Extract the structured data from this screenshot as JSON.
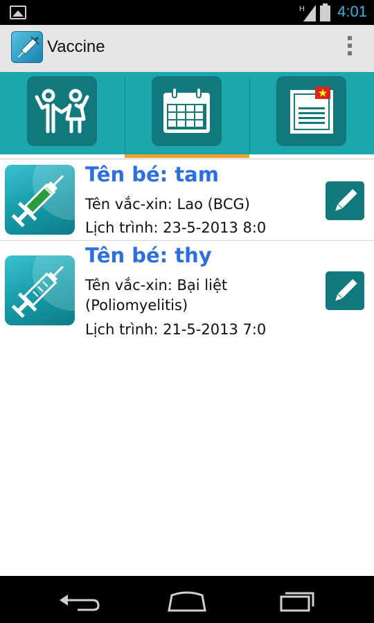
{
  "status_bar": {
    "time": "4:01",
    "icons": [
      "gallery-icon",
      "signal-icon",
      "battery-icon"
    ],
    "network_label": "H",
    "clock_color": "#33b5e5"
  },
  "action_bar": {
    "title": "Vaccine",
    "icons": [
      "syringe-app-icon",
      "overflow-menu-icon"
    ]
  },
  "tabs": [
    {
      "name": "children-tab",
      "icon": "children-icon",
      "selected": false
    },
    {
      "name": "schedule-tab",
      "icon": "calendar-icon",
      "selected": true
    },
    {
      "name": "news-tab",
      "icon": "news-icon",
      "selected": false
    }
  ],
  "colors": {
    "teal": "#1ca7ad",
    "dark_teal": "#11787d",
    "tab_indicator": "#f2a228",
    "name_blue": "#2b6fe0"
  },
  "vaccinations": [
    {
      "name": "Tên bé: tam",
      "vaccine": "Tên vắc-xin: Lao (BCG)",
      "schedule": "Lịch trình: 23-5-2013 8:0",
      "icon": "syringe-green-icon",
      "action_icon": "pencil-icon"
    },
    {
      "name": "Tên bé: thy",
      "vaccine": "Tên vắc-xin: Bại liệt",
      "vaccine_cont": "(Poliomyelitis)",
      "schedule": "Lịch trình: 21-5-2013 7:0",
      "icon": "syringe-empty-icon",
      "action_icon": "pencil-icon"
    }
  ],
  "nav_bar": {
    "icons": [
      "back-icon",
      "home-icon",
      "recent-apps-icon"
    ]
  }
}
